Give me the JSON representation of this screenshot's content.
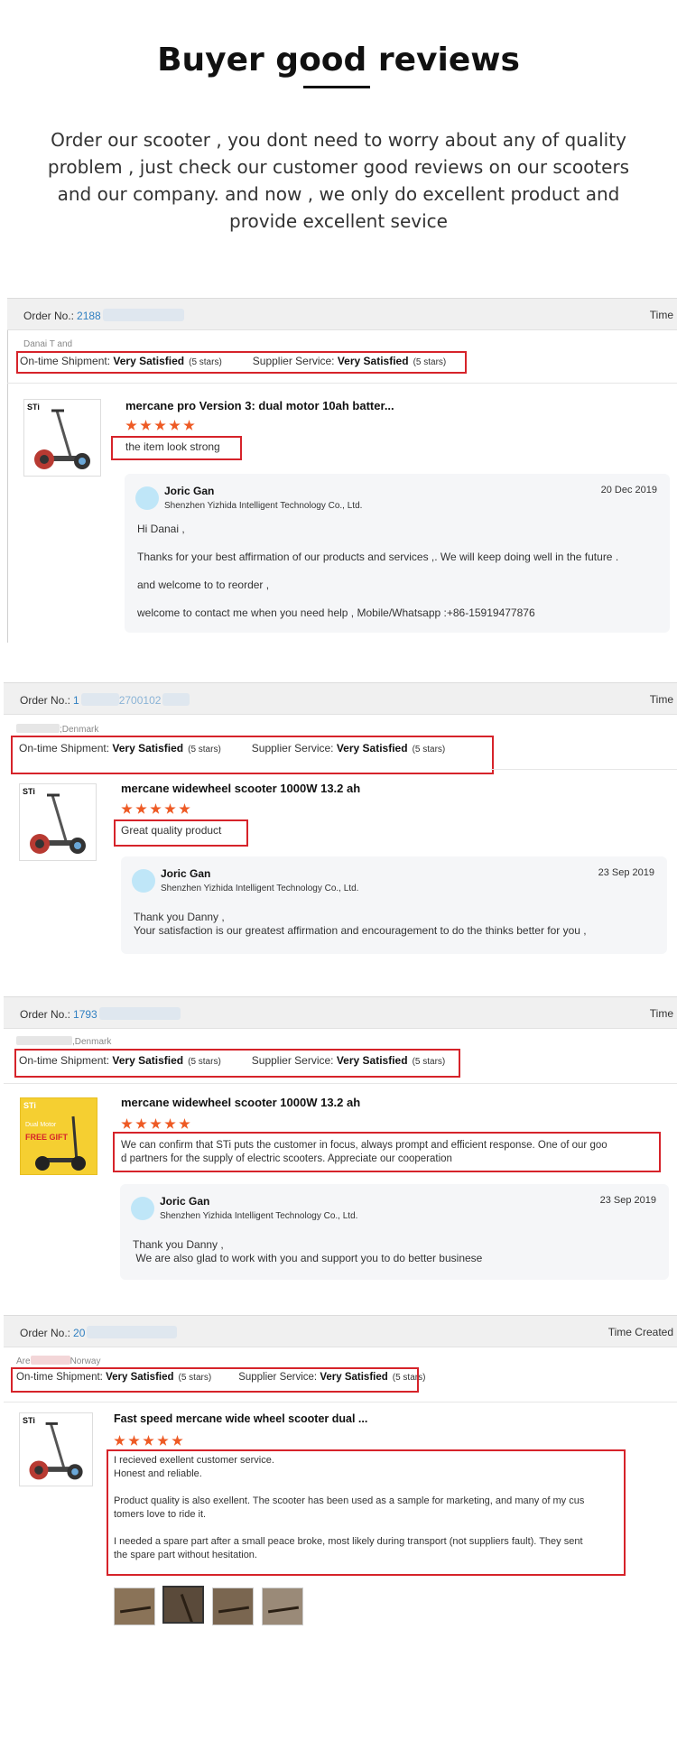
{
  "header": {
    "title": "Buyer good reviews",
    "intro": "Order our scooter  , you dont need to worry about any of quality problem , just check our customer good reviews on our scooters and our company. and now ,  we only do excellent product and provide excellent sevice"
  },
  "labels": {
    "order_no": "Order No.:",
    "ontime_label": "On-time Shipment:",
    "supplier_label": "Supplier Service:",
    "very_satisfied": "Very Satisfied",
    "five_stars": "(5 stars)",
    "brand": "STi"
  },
  "reviews": [
    {
      "order_prefix": "2188",
      "time_label": "Time",
      "location": "Danai T                    and",
      "product_title": "mercane pro Version 3: dual motor 10ah batter...",
      "rating": 5,
      "review_text": "the item look strong",
      "reply": {
        "name": "Joric Gan",
        "company": "Shenzhen Yizhida Intelligent Technology Co., Ltd.",
        "date": "20 Dec 2019",
        "lines": [
          "Hi Danai ,",
          "Thanks for your best affirmation of our products and services ,. We will keep doing well in the future .",
          "and welcome to to reorder ,",
          "welcome to contact me when you need help , Mobile/Whatsapp :+86-15919477876"
        ]
      }
    },
    {
      "order_prefix": "1",
      "order_suffix": "2700102",
      "time_label": "Time",
      "location": ";Denmark",
      "product_title": "mercane widewheel scooter 1000W 13.2 ah",
      "rating": 5,
      "review_text": "Great quality product",
      "reply": {
        "name": "Joric Gan",
        "company": "Shenzhen Yizhida Intelligent Technology Co., Ltd.",
        "date": "23 Sep 2019",
        "lines": [
          "Thank you Danny ,",
          "Your satisfaction is our greatest affirmation and encouragement to do the thinks better for you ,"
        ]
      }
    },
    {
      "order_prefix": "1793",
      "time_label": "Time",
      "location": ",Denmark",
      "product_title": "mercane widewheel scooter 1000W 13.2 ah",
      "rating": 5,
      "review_lines": [
        "We can confirm that STi puts the customer in focus, always prompt and efficient response. One of our goo",
        "d partners for the supply of electric scooters. Appreciate our cooperation"
      ],
      "thumb_text_1": "Dual Motor",
      "thumb_text_2": "FREE GIFT",
      "reply": {
        "name": "Joric Gan",
        "company": "Shenzhen Yizhida Intelligent Technology Co., Ltd.",
        "date": "23 Sep 2019",
        "lines": [
          "Thank you Danny ,",
          " We are also glad to work with you and support you to do better businese"
        ]
      }
    },
    {
      "order_prefix": "20",
      "time_label": "Time Created",
      "location_prefix": "Are",
      "location": "Norway",
      "product_title": "Fast speed mercane wide wheel scooter dual ...",
      "rating": 5,
      "review_lines": [
        "I recieved exellent customer service.",
        "Honest and reliable.",
        "",
        "Product quality is also exellent. The scooter has been used as a sample for marketing, and many of my cus",
        "tomers love to ride it.",
        "",
        "I needed a spare part after a small peace broke, most likely during transport (not suppliers fault). They sent",
        "the spare part without hesitation."
      ]
    }
  ]
}
